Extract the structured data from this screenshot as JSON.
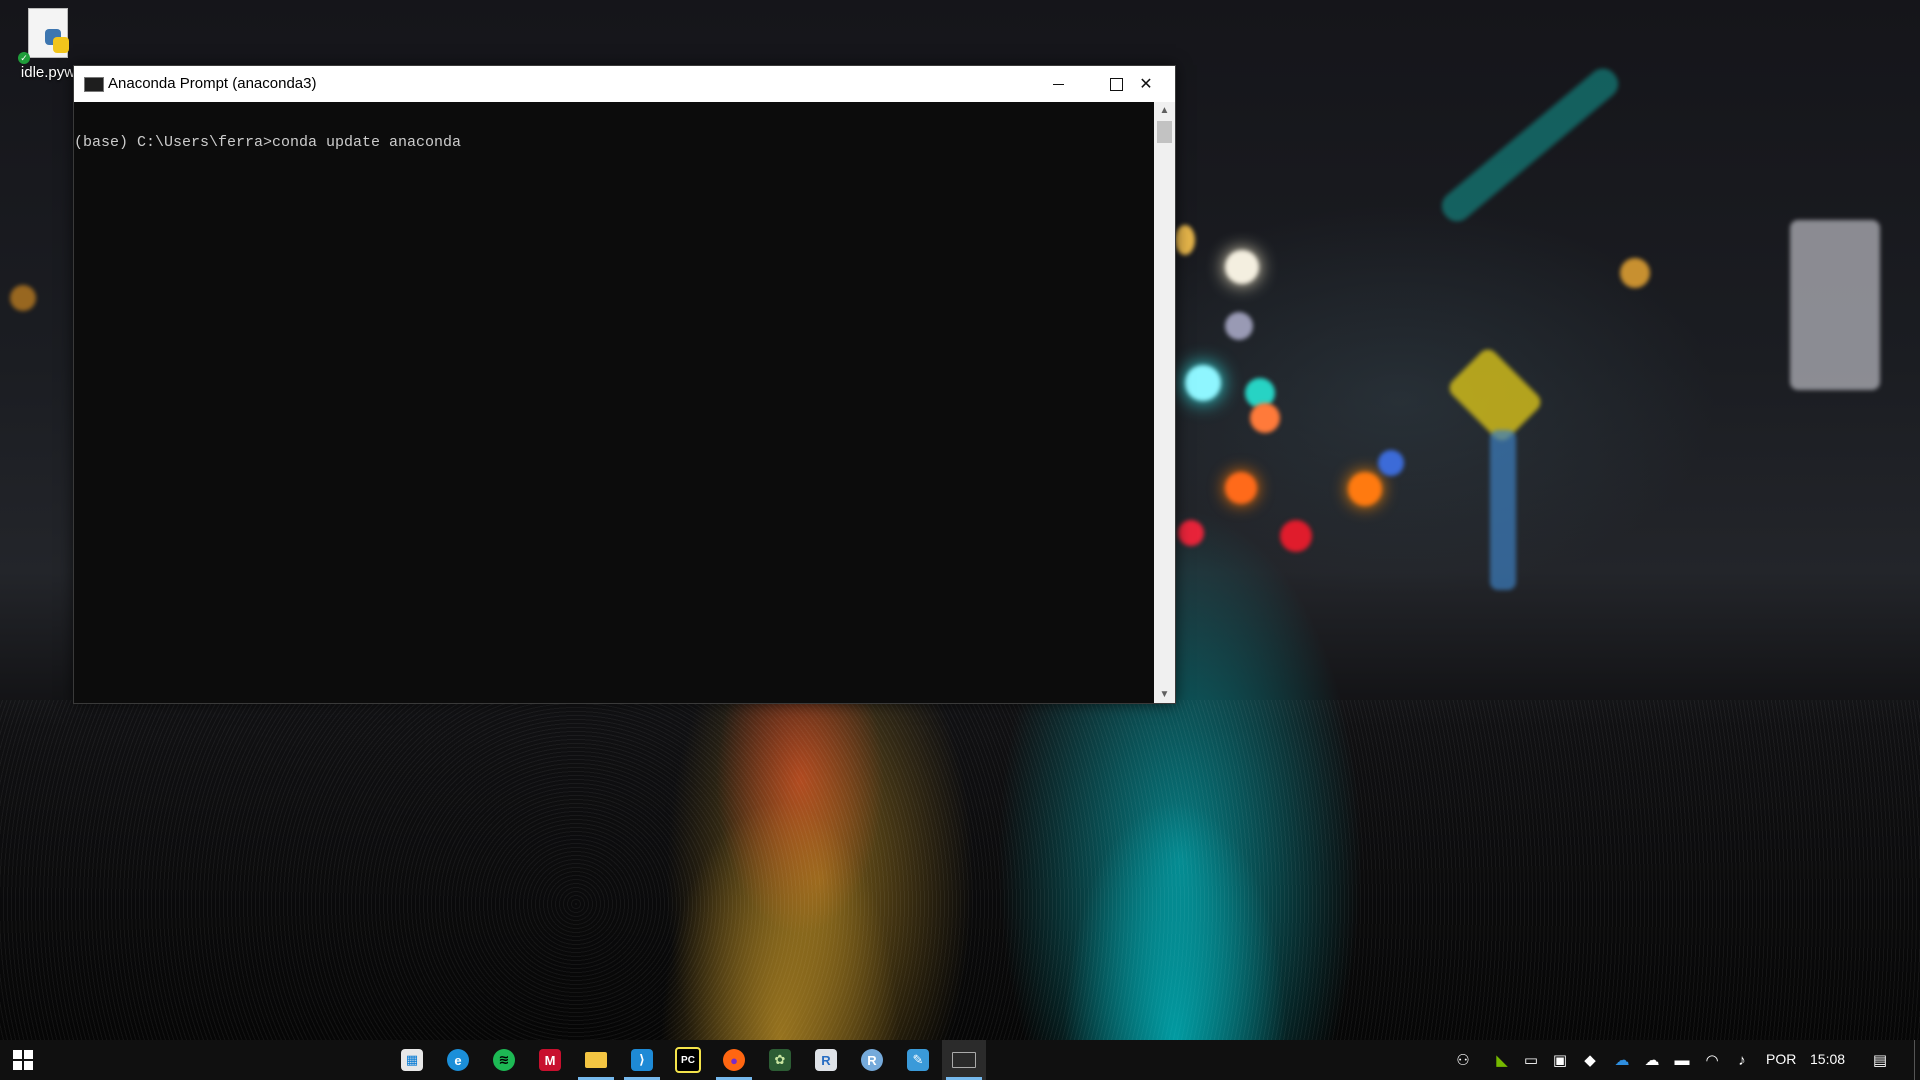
{
  "desktop": {
    "icons": [
      {
        "label": "idle.pyw"
      }
    ]
  },
  "window": {
    "title": "Anaconda Prompt (anaconda3)",
    "minimize_glyph": "",
    "maximize_glyph": "",
    "close_glyph": "✕",
    "console_lines": [
      "(base) C:\\Users\\ferra>conda update anaconda"
    ],
    "scroll_up_glyph": "▲",
    "scroll_down_glyph": "▼"
  },
  "taskbar": {
    "pinned_apps": [
      {
        "name": "microsoft-store",
        "glyph": "▦",
        "color": "#f0f0f0"
      },
      {
        "name": "edge",
        "glyph": "e",
        "color": "#1b8fd9"
      },
      {
        "name": "spotify",
        "glyph": "≋",
        "color": "#1db954"
      },
      {
        "name": "mendeley",
        "glyph": "M",
        "color": "#c8102e"
      },
      {
        "name": "file-explorer",
        "glyph": "",
        "color": "#f4c542"
      },
      {
        "name": "vscode",
        "glyph": "⟩",
        "color": "#1e8ad6"
      },
      {
        "name": "pycharm",
        "glyph": "PC",
        "color": "#000000"
      },
      {
        "name": "firefox",
        "glyph": "●",
        "color": "#ff6611"
      },
      {
        "name": "anaconda-navigator",
        "glyph": "✿",
        "color": "#44a833"
      },
      {
        "name": "r",
        "glyph": "R",
        "color": "#276dc3"
      },
      {
        "name": "rstudio",
        "glyph": "R",
        "color": "#75aadb"
      },
      {
        "name": "notepad",
        "glyph": "✎",
        "color": "#3a9ad9"
      },
      {
        "name": "anaconda-prompt",
        "glyph": "",
        "color": "#2a2a2a"
      }
    ],
    "tray": {
      "language": "POR",
      "time": "15:08"
    }
  }
}
